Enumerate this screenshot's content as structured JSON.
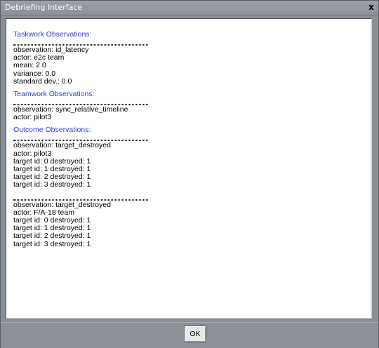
{
  "window": {
    "title": "Debriefing Interface",
    "close_glyph": "x"
  },
  "sections": {
    "taskwork": {
      "title": "Taskwork Observations:",
      "lines": [
        "observation: id_latency",
        "actor: e2c team",
        "mean: 2.0",
        "variance: 0.0",
        "standard dev.: 0.0"
      ]
    },
    "teamwork": {
      "title": "Teamwork Observations:",
      "lines": [
        "observation: sync_relative_timeline",
        "actor: pilot3"
      ]
    },
    "outcome": {
      "title": "Outcome Observations:",
      "blocks": [
        {
          "lines": [
            "observation: target_destroyed",
            "actor: pilot3",
            "target id: 0 destroyed: 1",
            "target id: 1 destroyed: 1",
            "target id: 2 destroyed: 1",
            "target id: 3 destroyed: 1"
          ]
        },
        {
          "lines": [
            "observation: target_destroyed",
            "actor: F/A-18 team",
            "target id: 0 destroyed: 1",
            "target id: 1 destroyed: 1",
            "target id: 2 destroyed: 1",
            "target id: 3 destroyed: 1"
          ]
        }
      ]
    }
  },
  "footer": {
    "ok_label": "OK"
  },
  "colors": {
    "section_title": "#2a3ee6",
    "chrome": "#8a9095"
  },
  "icons": {
    "close": "close-icon"
  }
}
